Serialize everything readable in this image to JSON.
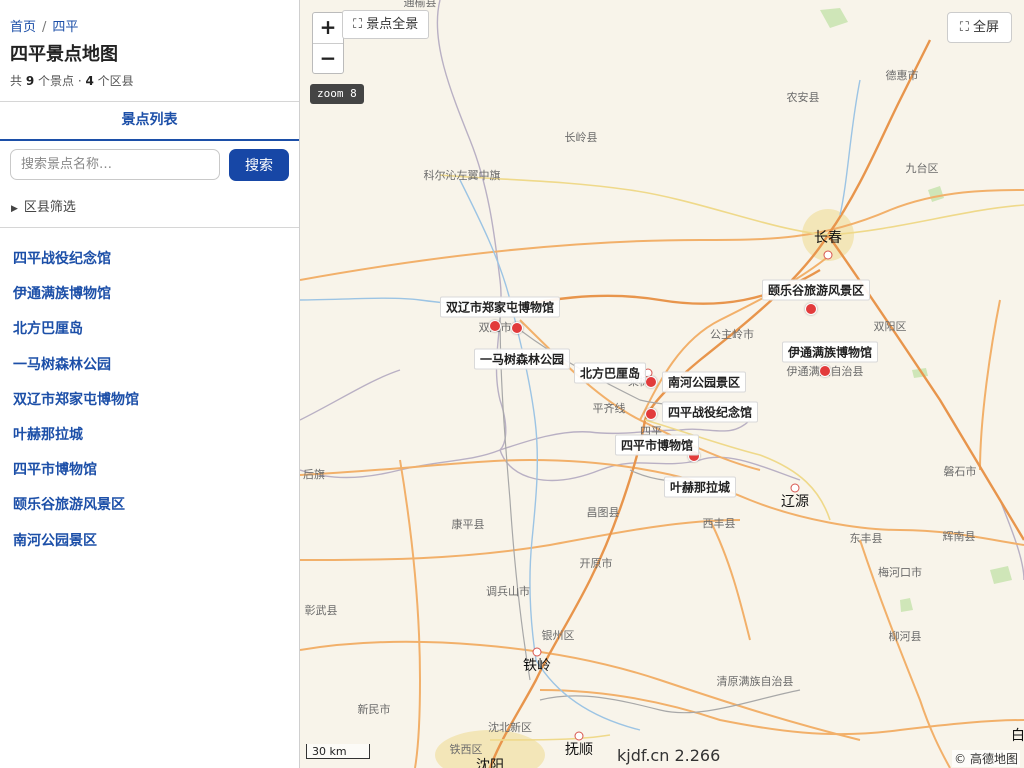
{
  "breadcrumb": {
    "home": "首页",
    "separator": "/",
    "current": "四平"
  },
  "page": {
    "title": "四平景点地图"
  },
  "summary": {
    "prefix": "共 ",
    "spot_count": "9",
    "mid": " 个景点 · ",
    "district_count": "4",
    "suffix": " 个区县"
  },
  "tab": {
    "label": "景点列表"
  },
  "search": {
    "placeholder": "搜索景点名称…",
    "button": "搜索"
  },
  "filter": {
    "label": "区县筛选"
  },
  "poi_list": [
    "四平战役纪念馆",
    "伊通满族博物馆",
    "北方巴厘岛",
    "一马树森林公园",
    "双辽市郑家屯博物馆",
    "叶赫那拉城",
    "四平市博物馆",
    "颐乐谷旅游风景区",
    "南河公园景区"
  ],
  "map": {
    "zoom_in": "+",
    "zoom_out": "−",
    "fit_button": "⛶ 景点全景",
    "fullscreen_button": "⛶ 全屏",
    "zoom_badge": "zoom 8",
    "scale": "30 km",
    "watermark": "kjdf.cn 2.266",
    "attribution": "© 高德地图",
    "place_labels": [
      "通榆县",
      "农安县",
      "德惠市",
      "长岭县",
      "科尔沁左翼中旗",
      "九台区",
      "长春",
      "公主岭市",
      "双阳区",
      "双辽市",
      "伊通满族自治县",
      "四平",
      "平齐线",
      "梨树",
      "后旗",
      "磐石市",
      "辽源",
      "康平县",
      "昌图县",
      "西丰县",
      "东丰县",
      "辉南县",
      "开原市",
      "梅河口市",
      "调兵山市",
      "彰武县",
      "银州区",
      "铁岭",
      "柳河县",
      "清原满族自治县",
      "新民市",
      "沈北新区",
      "铁西区",
      "抚顺",
      "沈阳",
      "白"
    ],
    "poi_tags": [
      "双辽市郑家屯博物馆",
      "一马树森林公园",
      "北方巴厘岛",
      "南河公园景区",
      "四平战役纪念馆",
      "四平市博物馆",
      "叶赫那拉城",
      "颐乐谷旅游风景区",
      "伊通满族博物馆"
    ]
  }
}
